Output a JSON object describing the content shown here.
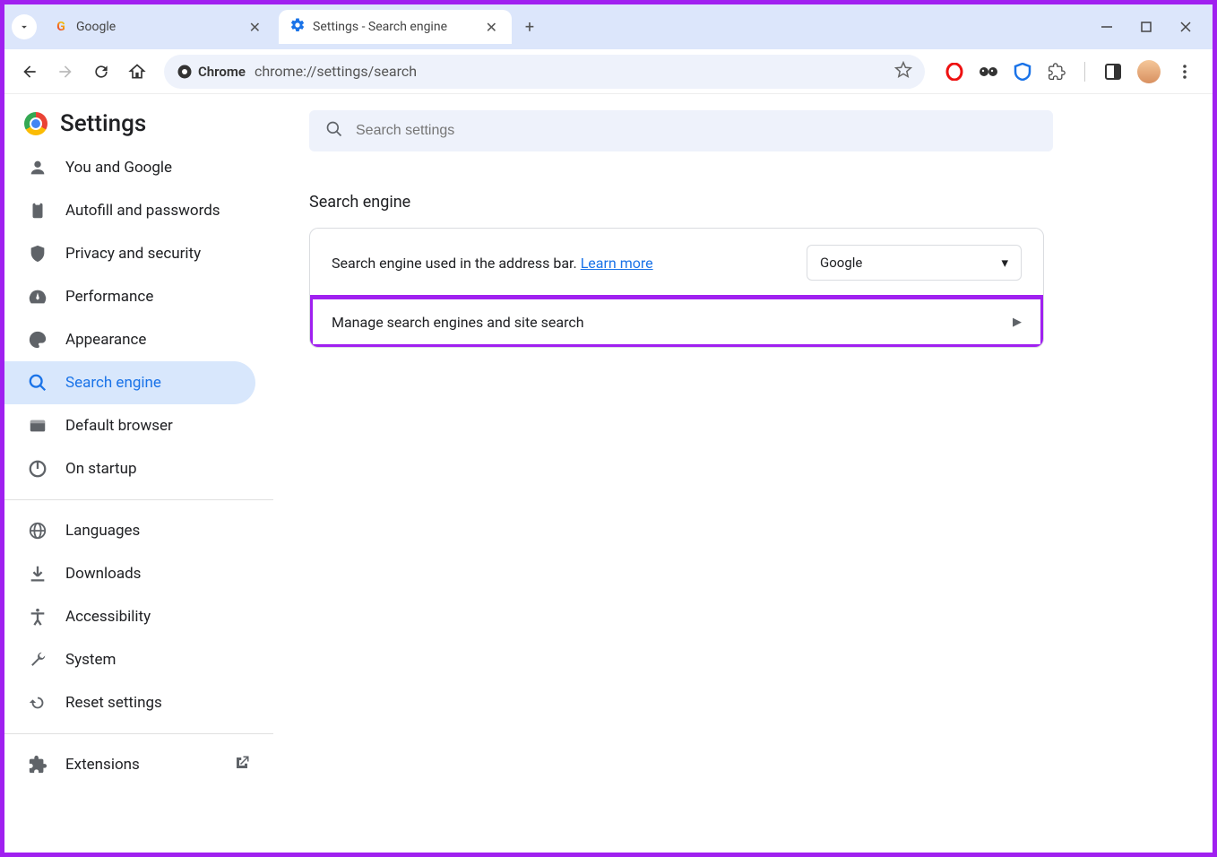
{
  "tabs": [
    {
      "title": "Google"
    },
    {
      "title": "Settings - Search engine"
    }
  ],
  "omnibox": {
    "chip": "Chrome",
    "url": "chrome://settings/search"
  },
  "settings": {
    "title": "Settings",
    "search_placeholder": "Search settings"
  },
  "sidebar": {
    "items": [
      "You and Google",
      "Autofill and passwords",
      "Privacy and security",
      "Performance",
      "Appearance",
      "Search engine",
      "Default browser",
      "On startup",
      "Languages",
      "Downloads",
      "Accessibility",
      "System",
      "Reset settings"
    ],
    "extensions": "Extensions"
  },
  "main": {
    "section_title": "Search engine",
    "row1_text": "Search engine used in the address bar. ",
    "row1_link": "Learn more",
    "select_value": "Google",
    "row2_text": "Manage search engines and site search"
  }
}
